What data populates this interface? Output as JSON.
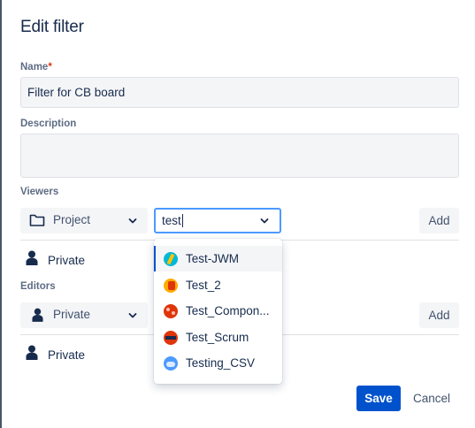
{
  "dialog": {
    "title": "Edit filter",
    "name": {
      "label": "Name",
      "required_marker": "*",
      "value": "Filter for CB board"
    },
    "description": {
      "label": "Description",
      "value": ""
    },
    "viewers": {
      "label": "Viewers",
      "type_select": "Project",
      "search_value": "test",
      "add_label": "Add",
      "current": "Private"
    },
    "editors": {
      "label": "Editors",
      "type_select": "Private",
      "add_label": "Add",
      "current": "Private"
    },
    "dropdown": {
      "options": [
        {
          "label": "Test-JWM",
          "icon": "project-avatar-jwm-icon",
          "active": true
        },
        {
          "label": "Test_2",
          "icon": "project-avatar-test2-icon"
        },
        {
          "label": "Test_Compon...",
          "icon": "project-avatar-components-icon"
        },
        {
          "label": "Test_Scrum",
          "icon": "project-avatar-scrum-icon"
        },
        {
          "label": "Testing_CSV",
          "icon": "project-avatar-csv-icon"
        }
      ]
    },
    "save_label": "Save",
    "cancel_label": "Cancel"
  },
  "colors": {
    "primary": "#0052cc",
    "focus_border": "#4c9aff",
    "text": "#172b4d",
    "subtle_text": "#5e6c84",
    "field_bg": "#f4f5f7",
    "required": "#de350b"
  }
}
